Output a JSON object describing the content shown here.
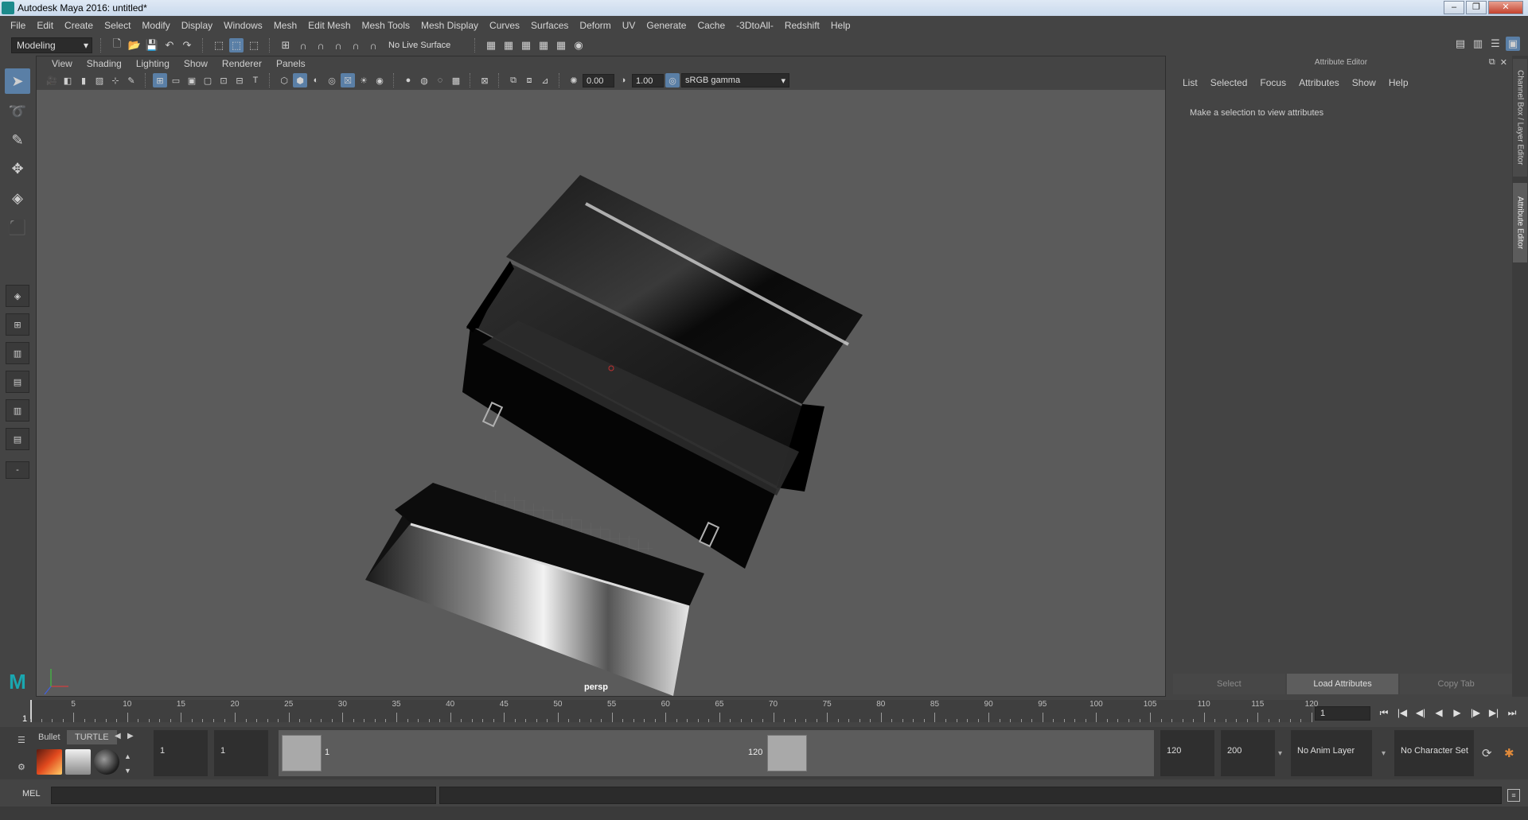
{
  "window": {
    "title": "Autodesk Maya 2016: untitled*",
    "min_glyph": "–",
    "restore_glyph": "❐",
    "close_glyph": "✕"
  },
  "menus": [
    "File",
    "Edit",
    "Create",
    "Select",
    "Modify",
    "Display",
    "Windows",
    "Mesh",
    "Edit Mesh",
    "Mesh Tools",
    "Mesh Display",
    "Curves",
    "Surfaces",
    "Deform",
    "UV",
    "Generate",
    "Cache",
    "-3DtoAll-",
    "Redshift",
    "Help"
  ],
  "statusline": {
    "mode": "Modeling",
    "live_surface": "No Live Surface"
  },
  "panel": {
    "menus": [
      "View",
      "Shading",
      "Lighting",
      "Show",
      "Renderer",
      "Panels"
    ],
    "exposure": "0.00",
    "gamma": "1.00",
    "color_space": "sRGB gamma",
    "camera": "persp"
  },
  "attribute_editor": {
    "header": "Attribute Editor",
    "menus": [
      "List",
      "Selected",
      "Focus",
      "Attributes",
      "Show",
      "Help"
    ],
    "message": "Make a selection to view attributes",
    "buttons": {
      "select": "Select",
      "load": "Load Attributes",
      "copy": "Copy Tab"
    }
  },
  "side_tabs": {
    "channel_box": "Channel Box / Layer Editor",
    "attribute_editor": "Attribute Editor"
  },
  "timeslider": {
    "ticks": [
      "5",
      "10",
      "15",
      "20",
      "25",
      "30",
      "35",
      "40",
      "45",
      "50",
      "55",
      "60",
      "65",
      "70",
      "75",
      "80",
      "85",
      "90",
      "95",
      "100",
      "105",
      "110",
      "115",
      "120"
    ],
    "start_tick": "1",
    "current_frame": "1",
    "frame_field": "1",
    "controls": [
      "⏮",
      "|◀",
      "◀|",
      "◀",
      "▶",
      "|▶",
      "▶|",
      "⏭"
    ]
  },
  "range": {
    "shelf_tabs": [
      "Bullet",
      "TURTLE"
    ],
    "start": "1",
    "playback_start": "1",
    "range_start_label": "1",
    "range_end_label": "120",
    "playback_end": "120",
    "end": "200",
    "anim_layer": "No Anim Layer",
    "character_set": "No Character Set"
  },
  "cmdline": {
    "label": "MEL"
  },
  "colors": {
    "accent": "#5a7fa6",
    "maya_teal": "#1aa7b0"
  },
  "icons": {
    "select_tool": "select-arrow-icon",
    "lasso": "lasso-icon",
    "paint": "paint-icon",
    "move": "move-icon",
    "rotate": "rotate-icon",
    "scale": "scale-icon"
  }
}
